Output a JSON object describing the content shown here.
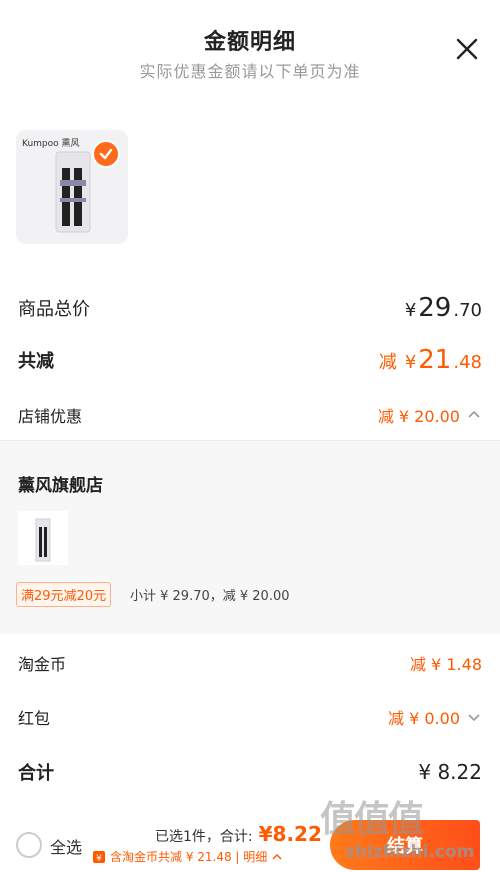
{
  "header": {
    "title": "金额明细",
    "subtitle": "实际优惠金额请以下单页为准"
  },
  "product": {
    "brand_logo": "Kumpoo 熏风",
    "selected": true
  },
  "summary": {
    "total_label": "商品总价",
    "total_currency": "¥",
    "total_int": "29",
    "total_dec": ".70",
    "discount_label": "共减",
    "discount_prefix": "减",
    "discount_currency": "¥",
    "discount_int": "21",
    "discount_dec": ".48",
    "shop_discount_label": "店铺优惠",
    "shop_discount_value": "减 ¥ 20.00"
  },
  "shop": {
    "name": "薰风旗舰店",
    "promo_tag": "满29元减20元",
    "subtotal": "小计 ¥ 29.70，减 ¥ 20.00"
  },
  "extras": {
    "coin_label": "淘金币",
    "coin_value": "减 ¥ 1.48",
    "redpacket_label": "红包",
    "redpacket_value": "减 ¥ 0.00",
    "sum_label": "合计",
    "sum_value": "¥ 8.22"
  },
  "bottom": {
    "select_all": "全选",
    "selected_count": "已选1件，合计:",
    "selected_total": "¥8.22",
    "discount_line": "含淘金币共减 ¥ 21.48 | 明细",
    "pay_label": "结算"
  },
  "watermark": {
    "text": "值值值",
    "url": "zhizhizhi.com"
  },
  "colors": {
    "accent": "#ff5a00",
    "checkbox": "#ff6a1a"
  }
}
